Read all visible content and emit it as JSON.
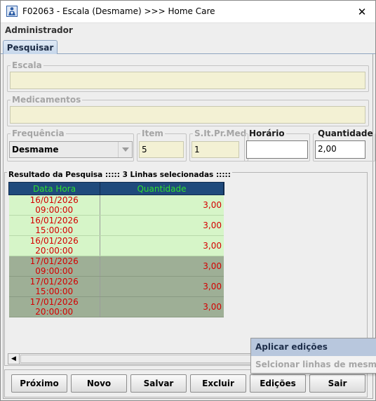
{
  "window": {
    "title": "F02063 - Escala (Desmame) >>> Home Care",
    "close_glyph": "✕",
    "icon": "app-person-icon"
  },
  "user": {
    "label": "Administrador"
  },
  "tabs": [
    {
      "label": "Pesquisar",
      "active": true
    }
  ],
  "form": {
    "escala": {
      "label": "Escala",
      "value": ""
    },
    "medicamentos": {
      "label": "Medicamentos",
      "value": ""
    },
    "frequencia": {
      "label": "Frequência",
      "value": "Desmame"
    },
    "item": {
      "label": "Item",
      "value": "5"
    },
    "slt": {
      "label": "S.It.Pr.Med",
      "value": "1"
    },
    "horario": {
      "label": "Horário",
      "value": ""
    },
    "quantidade": {
      "label": "Quantidade",
      "value": "2,00"
    }
  },
  "results": {
    "title": "Resultado da Pesquisa ::::: 3 Linhas selecionadas :::::",
    "columns": [
      "Data Hora",
      "Quantidade"
    ],
    "rows": [
      {
        "data_hora": "16/01/2026 09:00:00",
        "quantidade": "3,00",
        "style": "light"
      },
      {
        "data_hora": "16/01/2026 15:00:00",
        "quantidade": "3,00",
        "style": "light"
      },
      {
        "data_hora": "16/01/2026 20:00:00",
        "quantidade": "3,00",
        "style": "light"
      },
      {
        "data_hora": "17/01/2026 09:00:00",
        "quantidade": "3,00",
        "style": "dark"
      },
      {
        "data_hora": "17/01/2026 15:00:00",
        "quantidade": "3,00",
        "style": "dark"
      },
      {
        "data_hora": "17/01/2026 20:00:00",
        "quantidade": "3,00",
        "style": "dark"
      }
    ]
  },
  "buttons": {
    "proximo": "Próximo",
    "novo": "Novo",
    "salvar": "Salvar",
    "excluir": "Excluir",
    "edicoes": "Edições",
    "sair": "Sair"
  },
  "context_menu": {
    "items": [
      {
        "label": "Aplicar edições",
        "enabled": true
      },
      {
        "label": "Selcionar linhas de mesmo hor",
        "enabled": false
      }
    ]
  },
  "colors": {
    "header_bg": "#1f4a7c",
    "header_text": "#2ee02e",
    "cell_text": "#d40000",
    "row_light": "#d6f5c8",
    "row_dark": "#9eaf96",
    "readonly_field": "#f3f1d4"
  }
}
